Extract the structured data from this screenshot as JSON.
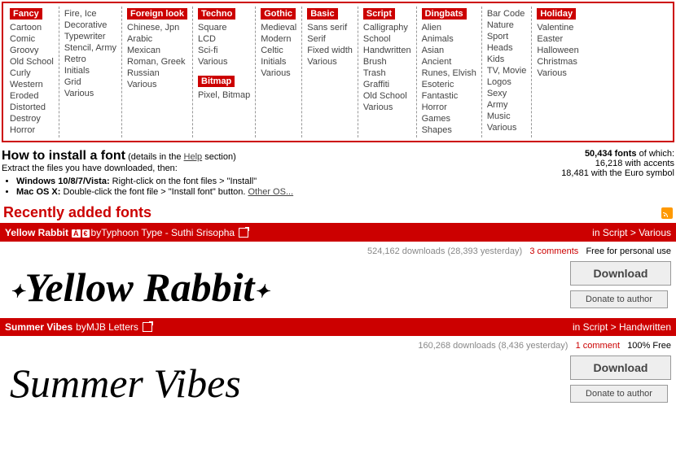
{
  "categories": [
    {
      "title": "Fancy",
      "items": [
        "Cartoon",
        "Comic",
        "Groovy",
        "Old School",
        "Curly",
        "Western",
        "Eroded",
        "Distorted",
        "Destroy",
        "Horror"
      ]
    },
    {
      "title": "",
      "items": [
        "Fire, Ice",
        "Decorative",
        "Typewriter",
        "Stencil, Army",
        "Retro",
        "Initials",
        "Grid",
        "Various"
      ]
    },
    {
      "title": "Foreign look",
      "items": [
        "Chinese, Jpn",
        "Arabic",
        "Mexican",
        "Roman, Greek",
        "Russian",
        "Various"
      ]
    },
    {
      "title": "Techno",
      "items": [
        "Square",
        "LCD",
        "Sci-fi",
        "Various"
      ],
      "title2": "Bitmap",
      "items2": [
        "Pixel, Bitmap"
      ]
    },
    {
      "title": "Gothic",
      "items": [
        "Medieval",
        "Modern",
        "Celtic",
        "Initials",
        "Various"
      ]
    },
    {
      "title": "Basic",
      "items": [
        "Sans serif",
        "Serif",
        "Fixed width",
        "Various"
      ]
    },
    {
      "title": "Script",
      "items": [
        "Calligraphy",
        "School",
        "Handwritten",
        "Brush",
        "Trash",
        "Graffiti",
        "Old School",
        "Various"
      ]
    },
    {
      "title": "Dingbats",
      "items": [
        "Alien",
        "Animals",
        "Asian",
        "Ancient",
        "Runes, Elvish",
        "Esoteric",
        "Fantastic",
        "Horror",
        "Games",
        "Shapes"
      ]
    },
    {
      "title": "",
      "items": [
        "Bar Code",
        "Nature",
        "Sport",
        "Heads",
        "Kids",
        "TV, Movie",
        "Logos",
        "Sexy",
        "Army",
        "Music",
        "Various"
      ]
    },
    {
      "title": "Holiday",
      "items": [
        "Valentine",
        "Easter",
        "Halloween",
        "Christmas",
        "Various"
      ]
    }
  ],
  "install": {
    "heading": "How to install a font",
    "details": "(details in the ",
    "help": "Help",
    "section": " section)",
    "extract": "Extract the files you have downloaded, then:",
    "win_label": "Windows 10/8/7/Vista:",
    "win_txt": " Right-click on the font files > \"Install\"",
    "mac_label": "Mac OS X:",
    "mac_txt": " Double-click the font file > \"Install font\" button. ",
    "other": "Other OS..."
  },
  "stats": {
    "total_num": "50,434 fonts",
    "total_suffix": " of which:",
    "accents": "16,218 with accents",
    "euro": "18,481 with the Euro symbol"
  },
  "recent": {
    "title": "Recently added fonts"
  },
  "fonts": [
    {
      "name": "Yellow Rabbit",
      "tags": [
        "À",
        "€"
      ],
      "by": " by ",
      "author": "Typhoon Type - Suthi Srisopha",
      "cat": "in Script > Various",
      "downloads": "524,162 downloads (28,393 yesterday)",
      "comments": "3 comments",
      "license": "Free for personal use",
      "download": "Download",
      "donate": "Donate to author",
      "preview": "Yellow Rabbit",
      "preview_class": "rabbit"
    },
    {
      "name": "Summer Vibes",
      "tags": [],
      "by": " by ",
      "author": "MJB Letters",
      "cat": "in Script > Handwritten",
      "downloads": "160,268 downloads (8,436 yesterday)",
      "comments": "1 comment",
      "license": "100% Free",
      "download": "Download",
      "donate": "Donate to author",
      "preview": "Summer Vibes",
      "preview_class": "vibes"
    }
  ]
}
